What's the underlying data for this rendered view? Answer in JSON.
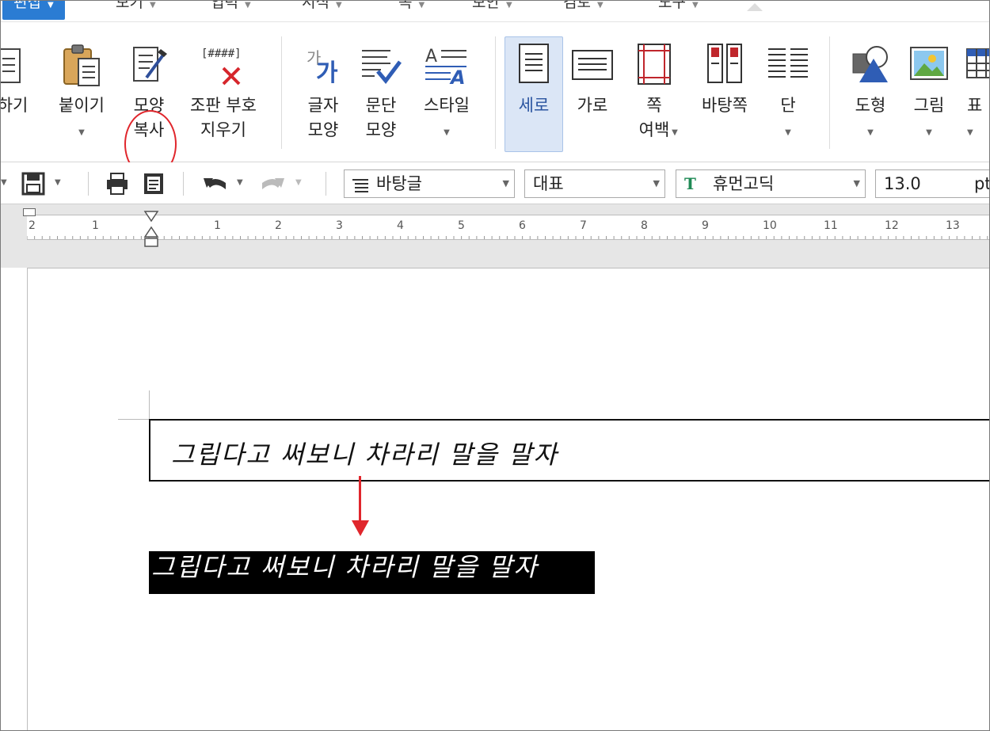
{
  "menubar": {
    "items": [
      {
        "label": "편집",
        "active": true
      },
      {
        "label": "보기"
      },
      {
        "label": "입력"
      },
      {
        "label": "서식"
      },
      {
        "label": "쪽"
      },
      {
        "label": "보안"
      },
      {
        "label": "검토"
      },
      {
        "label": "도구"
      }
    ]
  },
  "ribbon": {
    "buttons": [
      {
        "id": "copy",
        "label": "하기",
        "icon": "clipboard-icon"
      },
      {
        "id": "paste",
        "label": "붙이기",
        "icon": "paste-icon"
      },
      {
        "id": "format-copy",
        "label": "모양\n복사",
        "icon": "format-painter-icon"
      },
      {
        "id": "clear-marks",
        "label": "조판 부호\n지우기",
        "icon": "clear-marks-icon"
      },
      {
        "id": "char-shape",
        "label": "글자\n모양",
        "icon": "char-shape-icon"
      },
      {
        "id": "para-shape",
        "label": "문단\n모양",
        "icon": "para-shape-icon"
      },
      {
        "id": "style",
        "label": "스타일",
        "icon": "style-icon"
      },
      {
        "id": "portrait",
        "label": "세로",
        "icon": "portrait-page-icon"
      },
      {
        "id": "landscape",
        "label": "가로",
        "icon": "landscape-page-icon"
      },
      {
        "id": "page-margin",
        "label": "쪽\n여백",
        "icon": "page-margin-icon"
      },
      {
        "id": "master-page",
        "label": "바탕쪽",
        "icon": "master-page-icon"
      },
      {
        "id": "columns",
        "label": "단",
        "icon": "columns-icon"
      },
      {
        "id": "shape",
        "label": "도형",
        "icon": "shape-icon"
      },
      {
        "id": "picture",
        "label": "그림",
        "icon": "picture-icon"
      },
      {
        "id": "table",
        "label": "표",
        "icon": "table-icon"
      }
    ]
  },
  "toolbar": {
    "style_select": "바탕글",
    "language_select": "대표",
    "font_select": "휴먼고딕",
    "font_size": "13.0",
    "font_unit": "pt"
  },
  "ruler": {
    "labels": [
      "2",
      "1",
      "1",
      "2",
      "3",
      "4",
      "5",
      "6",
      "7",
      "8",
      "9",
      "10",
      "11",
      "12",
      "13"
    ]
  },
  "document": {
    "line1": "그립다고 써보니 차라리 말을 말자",
    "line2": "그립다고 써보니 차라리 말을 말자"
  },
  "colors": {
    "accent": "#2b7cd3",
    "annotation": "#e0262c",
    "selected_button": "#dbe6f6"
  }
}
